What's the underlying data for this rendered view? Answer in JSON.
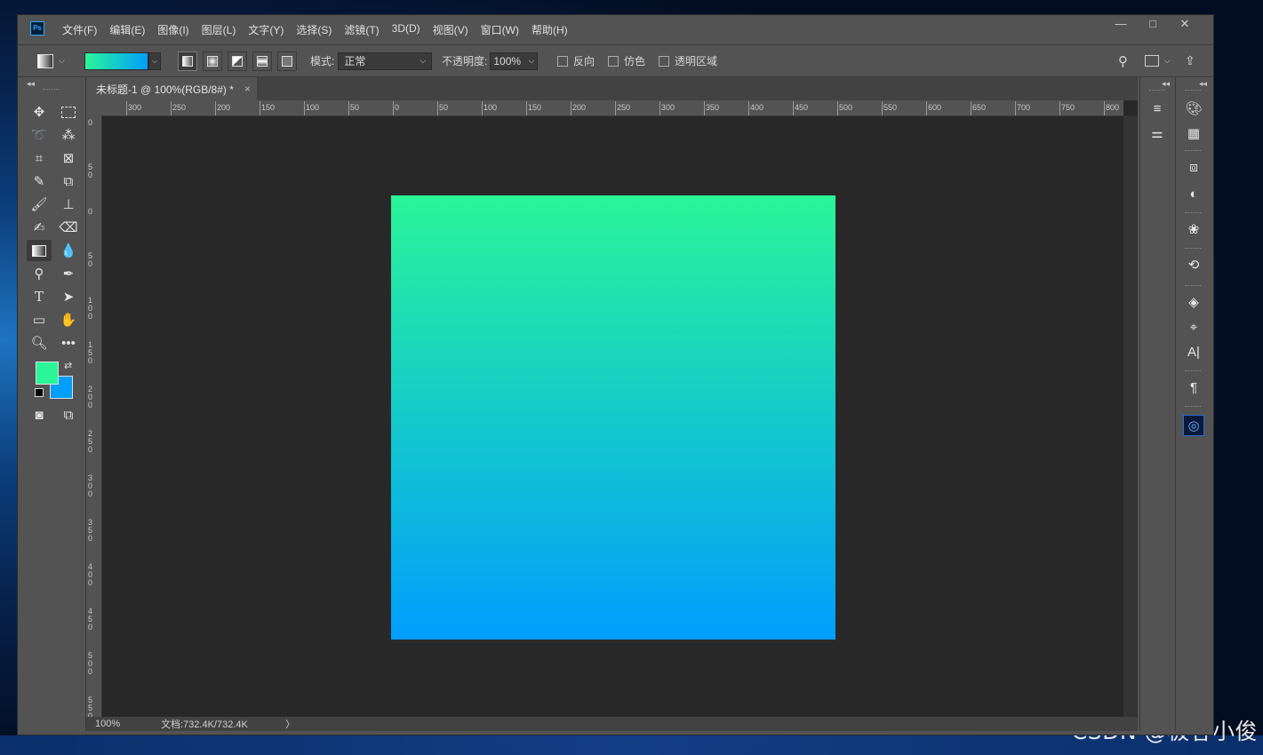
{
  "app": {
    "logo": "Ps"
  },
  "menu": [
    "文件(F)",
    "编辑(E)",
    "图像(I)",
    "图层(L)",
    "文字(Y)",
    "选择(S)",
    "滤镜(T)",
    "3D(D)",
    "视图(V)",
    "窗口(W)",
    "帮助(H)"
  ],
  "window_controls": {
    "minimize": "—",
    "maximize": "□",
    "close": "✕"
  },
  "options": {
    "gradient_colors": [
      "#2af598",
      "#009efd"
    ],
    "mode_label": "模式:",
    "mode_value": "正常",
    "opacity_label": "不透明度:",
    "opacity_value": "100%",
    "reverse_label": "反向",
    "dither_label": "仿色",
    "transparency_label": "透明区域"
  },
  "document": {
    "tab_title": "未标题-1 @ 100%(RGB/8#) *",
    "tab_close": "×",
    "canvas_gradient": [
      "#2af598",
      "#009efd"
    ],
    "ruler_h_labels": [
      "300",
      "250",
      "200",
      "150",
      "100",
      "50",
      "0",
      "50",
      "100",
      "150",
      "200",
      "250",
      "300",
      "350",
      "400",
      "450",
      "500",
      "550",
      "600",
      "650",
      "700",
      "750",
      "800"
    ],
    "ruler_v_labels": [
      "0",
      "50",
      "0",
      "50",
      "100",
      "150",
      "200",
      "250",
      "300",
      "350",
      "400",
      "450",
      "500",
      "550"
    ]
  },
  "status": {
    "zoom": "100%",
    "doc_info": "文档:732.4K/732.4K",
    "arrow": "〉"
  },
  "colors": {
    "foreground": "#2af598",
    "background": "#009efd"
  },
  "watermark": "CSDN @极客小俊"
}
